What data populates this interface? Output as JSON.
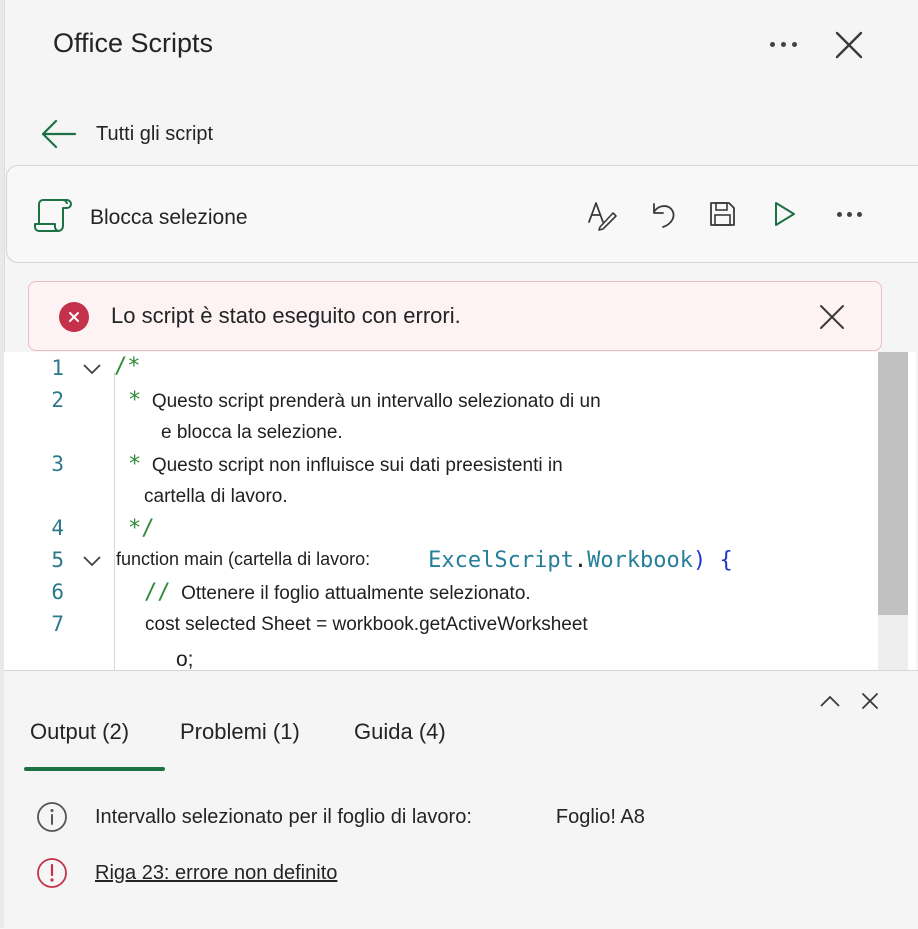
{
  "header": {
    "title": "Office Scripts"
  },
  "nav": {
    "back_label": "Tutti gli script"
  },
  "script": {
    "name": "Blocca selezione"
  },
  "error_banner": {
    "message": "Lo script è stato eseguito con errori."
  },
  "editor": {
    "line_numbers": [
      "1",
      "2",
      "3",
      "4",
      "5",
      "6",
      "7"
    ],
    "lines": {
      "l1": "/*",
      "l2_star": "*",
      "l2_text": "Questo script prenderà un intervallo selezionato di un",
      "l2_cont": "e blocca la selezione.",
      "l3_star": "*",
      "l3_text": "Questo script non influisce sui dati preesistenti in",
      "l3_cont": "cartella di lavoro.",
      "l4": "*/",
      "l5_text": "function main (cartella di lavoro:",
      "l5_type_a": "ExcelScript",
      "l5_dot": ".",
      "l5_type_b": "Workbook",
      "l5_brace": ") {",
      "l6_slash": "//",
      "l6_text": "Ottenere il foglio attualmente selezionato.",
      "l7_text": "cost selected Sheet = workbook.getActiveWorksheet",
      "l7_cont": "o;"
    }
  },
  "output_panel": {
    "tabs": [
      "Output (2)",
      "Problemi (1)",
      "Guida (4)"
    ],
    "active_tab": 0,
    "rows": [
      {
        "icon": "info-icon",
        "text": "Intervallo selezionato per il foglio di lavoro:",
        "value": "Foglio! A8"
      },
      {
        "icon": "error-icon",
        "text": "Riga 23: errore non definito"
      }
    ]
  },
  "colors": {
    "accent_green": "#1e7145",
    "error_red": "#c4314b",
    "comment_green": "#2e8b3a",
    "type_teal": "#267f99",
    "line_number": "#2b7989"
  }
}
